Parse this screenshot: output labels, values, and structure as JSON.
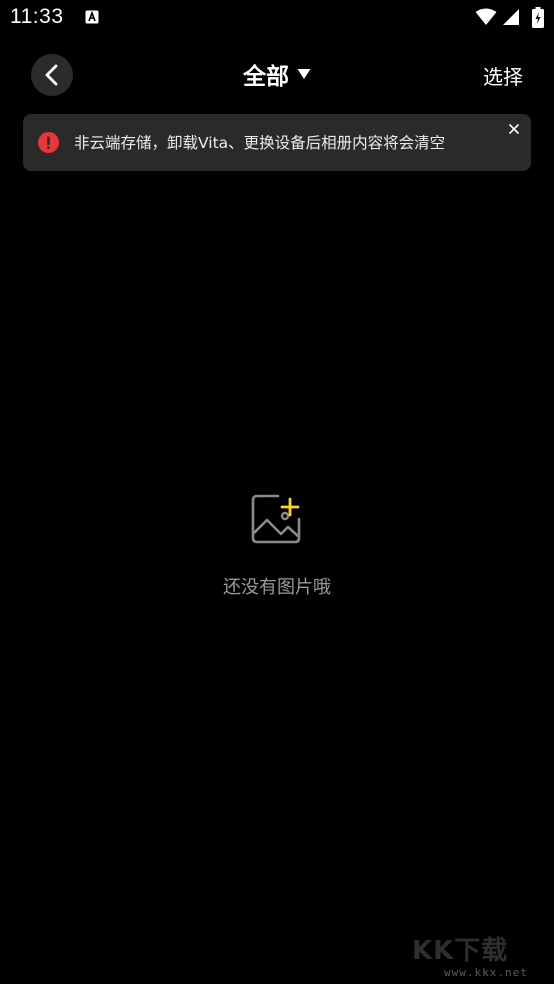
{
  "status_bar": {
    "time": "11:33"
  },
  "header": {
    "title": "全部",
    "select_label": "选择"
  },
  "notice": {
    "text": "非云端存储，卸载Vita、更换设备后相册内容将会清空",
    "accent_color": "#e8363a"
  },
  "empty_state": {
    "message": "还没有图片哦",
    "icon_accent_color": "#ffd21e"
  },
  "watermark": {
    "logo_text": "KK下载",
    "url": "www.kkx.net"
  },
  "icons": {
    "back": "chevron-left-icon",
    "dropdown": "caret-down-icon",
    "notice": "alert-icon",
    "close": "close-icon",
    "empty": "add-image-icon"
  }
}
